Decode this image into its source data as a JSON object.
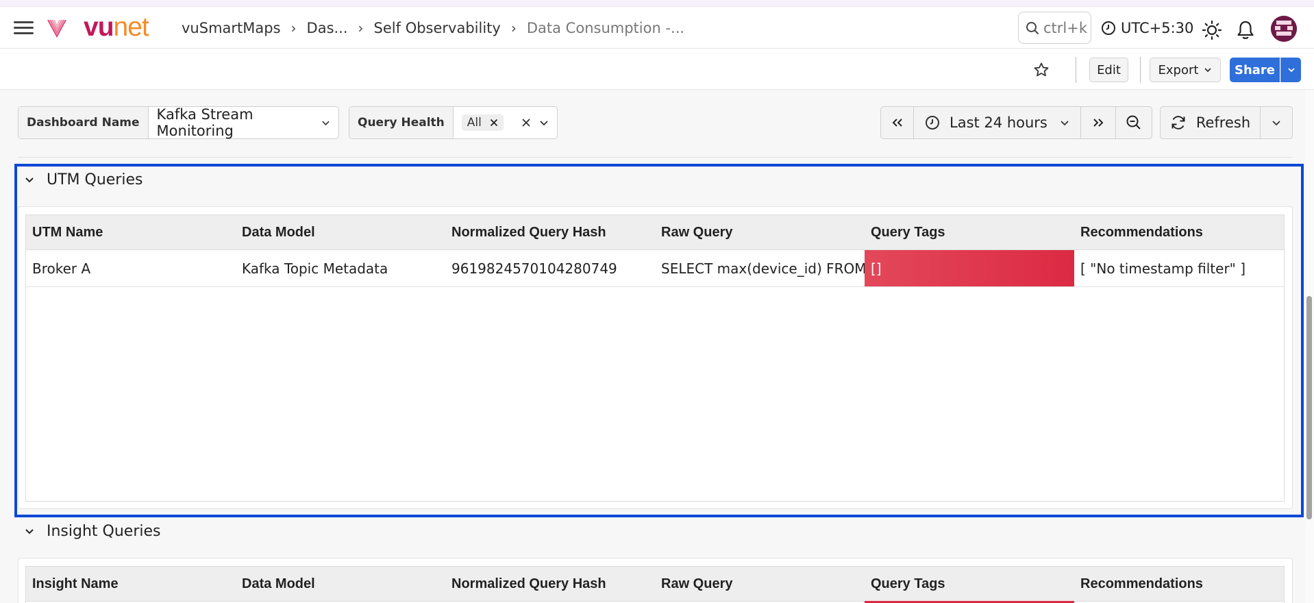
{
  "brand": {
    "vu": "vu",
    "net": "net"
  },
  "breadcrumb": {
    "items": [
      "vuSmartMaps",
      "Das...",
      "Self Observability",
      "Data Consumption -..."
    ]
  },
  "search": {
    "placeholder": "ctrl+k"
  },
  "timezone": {
    "label": "UTC+5:30"
  },
  "actions": {
    "edit": "Edit",
    "export": "Export",
    "share": "Share"
  },
  "filters": {
    "dashboard_name": {
      "label": "Dashboard Name",
      "value": "Kafka Stream Monitoring"
    },
    "query_health": {
      "label": "Query Health",
      "chip": "All"
    }
  },
  "time_picker": {
    "range": "Last 24 hours"
  },
  "refresh": {
    "label": "Refresh"
  },
  "utm_panel": {
    "title": "UTM Queries",
    "columns": [
      "UTM Name",
      "Data Model",
      "Normalized Query Hash",
      "Raw Query",
      "Query Tags",
      "Recommendations"
    ],
    "rows": [
      [
        "Broker A",
        "Kafka Topic Metadata",
        "9619824570104280749",
        "SELECT max(device_id) FROM v",
        "[]",
        "[ \"No timestamp filter\" ]"
      ]
    ]
  },
  "insight_panel": {
    "title": "Insight Queries",
    "columns": [
      "Insight Name",
      "Data Model",
      "Normalized Query Hash",
      "Raw Query",
      "Query Tags",
      "Recommendations"
    ]
  },
  "colors": {
    "accent": "#2f6fd9",
    "highlight": "#0b49d6",
    "tag_red": "#dc2a43",
    "brand_vu": "#c2185b",
    "brand_net": "#f28c28"
  },
  "icons": [
    "menu-icon",
    "vunet-logo-icon",
    "chevron-right-icon",
    "search-icon",
    "clock-icon",
    "sun-icon",
    "bell-icon",
    "avatar-icon",
    "star-icon",
    "chevron-down-icon",
    "close-icon",
    "double-chevron-left-icon",
    "double-chevron-right-icon",
    "zoom-out-icon",
    "refresh-icon"
  ]
}
